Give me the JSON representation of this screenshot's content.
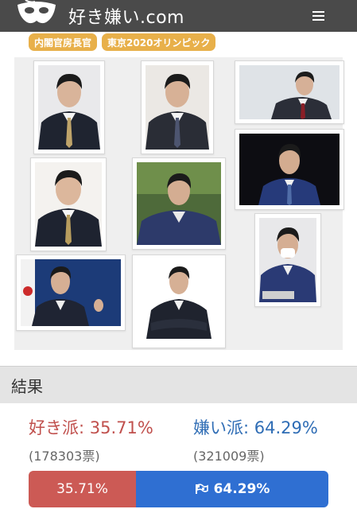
{
  "header": {
    "logo_text": "好き嫌い.com"
  },
  "tags": [
    {
      "label": "内閣官房長官"
    },
    {
      "label": "東京2020オリンピック"
    }
  ],
  "result": {
    "title": "結果",
    "like": {
      "label": "好き派: 35.71%",
      "votes": "(178303票)",
      "bar_label": "35.71%",
      "fraction": 0.3571
    },
    "dislike": {
      "label": "嫌い派: 64.29%",
      "votes": "(321009票)",
      "bar_label": "64.29%",
      "fraction": 0.6429
    }
  },
  "colors": {
    "like": "#cc5a55",
    "dislike": "#2f6fd2",
    "tag": "#e8b04a",
    "header": "#4a4a4a"
  },
  "icons": {
    "logo": "mask-icon",
    "menu": "hamburger-menu-icon",
    "bar_marker": "flag-icon"
  }
}
